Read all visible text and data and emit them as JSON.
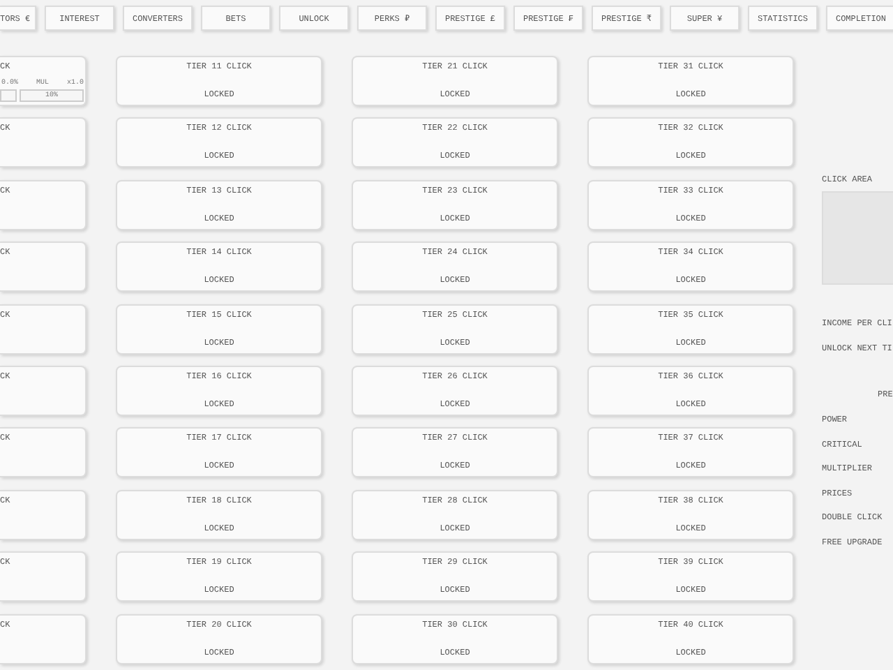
{
  "nav_tabs": [
    "TORS €",
    "INTEREST",
    "CONVERTERS",
    "BETS",
    "UNLOCK",
    "PERKS ₽",
    "PRESTIGE £",
    "PRESTIGE ₣",
    "PRESTIGE ₹",
    "SUPER ¥",
    "STATISTICS",
    "COMPLETION"
  ],
  "tier_columns": [
    {
      "cards": [
        {
          "title": "CK",
          "stats": [
            "0.0%",
            "MUL",
            "x1.0"
          ],
          "button": "10%"
        },
        {
          "title": "CK"
        },
        {
          "title": "CK"
        },
        {
          "title": "CK"
        },
        {
          "title": "CK"
        },
        {
          "title": "CK"
        },
        {
          "title": "CK"
        },
        {
          "title": "CK"
        },
        {
          "title": "CK"
        },
        {
          "title": "CK"
        }
      ]
    },
    {
      "cards": [
        {
          "title": "TIER 11 CLICK",
          "status": "LOCKED"
        },
        {
          "title": "TIER 12 CLICK",
          "status": "LOCKED"
        },
        {
          "title": "TIER 13 CLICK",
          "status": "LOCKED"
        },
        {
          "title": "TIER 14 CLICK",
          "status": "LOCKED"
        },
        {
          "title": "TIER 15 CLICK",
          "status": "LOCKED"
        },
        {
          "title": "TIER 16 CLICK",
          "status": "LOCKED"
        },
        {
          "title": "TIER 17 CLICK",
          "status": "LOCKED"
        },
        {
          "title": "TIER 18 CLICK",
          "status": "LOCKED"
        },
        {
          "title": "TIER 19 CLICK",
          "status": "LOCKED"
        },
        {
          "title": "TIER 20 CLICK",
          "status": "LOCKED"
        }
      ]
    },
    {
      "cards": [
        {
          "title": "TIER 21 CLICK",
          "status": "LOCKED"
        },
        {
          "title": "TIER 22 CLICK",
          "status": "LOCKED"
        },
        {
          "title": "TIER 23 CLICK",
          "status": "LOCKED"
        },
        {
          "title": "TIER 24 CLICK",
          "status": "LOCKED"
        },
        {
          "title": "TIER 25 CLICK",
          "status": "LOCKED"
        },
        {
          "title": "TIER 26 CLICK",
          "status": "LOCKED"
        },
        {
          "title": "TIER 27 CLICK",
          "status": "LOCKED"
        },
        {
          "title": "TIER 28 CLICK",
          "status": "LOCKED"
        },
        {
          "title": "TIER 29 CLICK",
          "status": "LOCKED"
        },
        {
          "title": "TIER 30 CLICK",
          "status": "LOCKED"
        }
      ]
    },
    {
      "cards": [
        {
          "title": "TIER 31 CLICK",
          "status": "LOCKED"
        },
        {
          "title": "TIER 32 CLICK",
          "status": "LOCKED"
        },
        {
          "title": "TIER 33 CLICK",
          "status": "LOCKED"
        },
        {
          "title": "TIER 34 CLICK",
          "status": "LOCKED"
        },
        {
          "title": "TIER 35 CLICK",
          "status": "LOCKED"
        },
        {
          "title": "TIER 36 CLICK",
          "status": "LOCKED"
        },
        {
          "title": "TIER 37 CLICK",
          "status": "LOCKED"
        },
        {
          "title": "TIER 38 CLICK",
          "status": "LOCKED"
        },
        {
          "title": "TIER 39 CLICK",
          "status": "LOCKED"
        },
        {
          "title": "TIER 40 CLICK",
          "status": "LOCKED"
        }
      ]
    }
  ],
  "side_panel": {
    "click_area_label": "CLICK AREA",
    "info_lines": [
      "INCOME PER CLI",
      "UNLOCK NEXT TI"
    ],
    "perks_heading": "PRE",
    "perks": [
      "POWER",
      "CRITICAL",
      "MULTIPLIER",
      "PRICES",
      "DOUBLE CLICK",
      "FREE UPGRADE"
    ]
  }
}
